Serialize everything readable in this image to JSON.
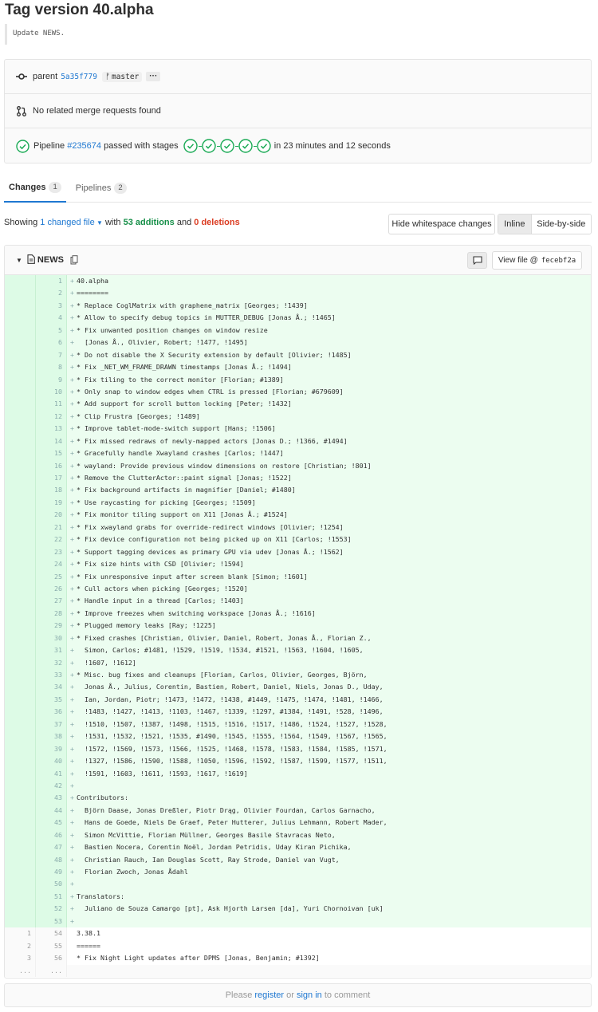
{
  "page": {
    "title": "Tag version 40.alpha",
    "description": "Update NEWS."
  },
  "info": {
    "parent_label": "parent",
    "parent_sha": "5a35f779",
    "branch": "master",
    "ellipsis": "···",
    "merge_requests": "No related merge requests found",
    "pipeline_prefix": "Pipeline",
    "pipeline_id": "#235674",
    "pipeline_status": "passed with stages",
    "pipeline_duration": "in 23 minutes and 12 seconds",
    "stage_count": 5,
    "success_color": "#1aaa55"
  },
  "tabs": [
    {
      "label": "Changes",
      "count": "1"
    },
    {
      "label": "Pipelines",
      "count": "2"
    }
  ],
  "summary": {
    "showing": "Showing",
    "changed": "1 changed file",
    "with": "with",
    "additions": "53 additions",
    "and": "and",
    "deletions": "0 deletions"
  },
  "toolbar": {
    "hide_whitespace": "Hide whitespace changes",
    "inline": "Inline",
    "side_by_side": "Side-by-side"
  },
  "file": {
    "name": "NEWS",
    "view_file_label": "View file @",
    "view_file_sha": "fecebf2a"
  },
  "diff_lines": [
    {
      "t": "add",
      "o": "",
      "n": "1",
      "c": "40.alpha"
    },
    {
      "t": "add",
      "o": "",
      "n": "2",
      "c": "========"
    },
    {
      "t": "add",
      "o": "",
      "n": "3",
      "c": "* Replace CoglMatrix with graphene_matrix [Georges; !1439]"
    },
    {
      "t": "add",
      "o": "",
      "n": "4",
      "c": "* Allow to specify debug topics in MUTTER_DEBUG [Jonas Å.; !1465]"
    },
    {
      "t": "add",
      "o": "",
      "n": "5",
      "c": "* Fix unwanted position changes on window resize"
    },
    {
      "t": "add",
      "o": "",
      "n": "6",
      "c": "  [Jonas Å., Olivier, Robert; !1477, !1495]"
    },
    {
      "t": "add",
      "o": "",
      "n": "7",
      "c": "* Do not disable the X Security extension by default [Olivier; !1485]"
    },
    {
      "t": "add",
      "o": "",
      "n": "8",
      "c": "* Fix _NET_WM_FRAME_DRAWN timestamps [Jonas Å.; !1494]"
    },
    {
      "t": "add",
      "o": "",
      "n": "9",
      "c": "* Fix tiling to the correct monitor [Florian; #1389]"
    },
    {
      "t": "add",
      "o": "",
      "n": "10",
      "c": "* Only snap to window edges when CTRL is pressed [Florian; #679609]"
    },
    {
      "t": "add",
      "o": "",
      "n": "11",
      "c": "* Add support for scroll button locking [Peter; !1432]"
    },
    {
      "t": "add",
      "o": "",
      "n": "12",
      "c": "* Clip Frustra [Georges; !1489]"
    },
    {
      "t": "add",
      "o": "",
      "n": "13",
      "c": "* Improve tablet-mode-switch support [Hans; !1506]"
    },
    {
      "t": "add",
      "o": "",
      "n": "14",
      "c": "* Fix missed redraws of newly-mapped actors [Jonas D.; !1366, #1494]"
    },
    {
      "t": "add",
      "o": "",
      "n": "15",
      "c": "* Gracefully handle Xwayland crashes [Carlos; !1447]"
    },
    {
      "t": "add",
      "o": "",
      "n": "16",
      "c": "* wayland: Provide previous window dimensions on restore [Christian; !801]"
    },
    {
      "t": "add",
      "o": "",
      "n": "17",
      "c": "* Remove the ClutterActor::paint signal [Jonas; !1522]"
    },
    {
      "t": "add",
      "o": "",
      "n": "18",
      "c": "* Fix background artifacts in magnifier [Daniel; #1480]"
    },
    {
      "t": "add",
      "o": "",
      "n": "19",
      "c": "* Use raycasting for picking [Georges; !1509]"
    },
    {
      "t": "add",
      "o": "",
      "n": "20",
      "c": "* Fix monitor tiling support on X11 [Jonas Å.; #1524]"
    },
    {
      "t": "add",
      "o": "",
      "n": "21",
      "c": "* Fix xwayland grabs for override-redirect windows [Olivier; !1254]"
    },
    {
      "t": "add",
      "o": "",
      "n": "22",
      "c": "* Fix device configuration not being picked up on X11 [Carlos; !1553]"
    },
    {
      "t": "add",
      "o": "",
      "n": "23",
      "c": "* Support tagging devices as primary GPU via udev [Jonas Å.; !1562]"
    },
    {
      "t": "add",
      "o": "",
      "n": "24",
      "c": "* Fix size hints with CSD [Olivier; !1594]"
    },
    {
      "t": "add",
      "o": "",
      "n": "25",
      "c": "* Fix unresponsive input after screen blank [Simon; !1601]"
    },
    {
      "t": "add",
      "o": "",
      "n": "26",
      "c": "* Cull actors when picking [Georges; !1520]"
    },
    {
      "t": "add",
      "o": "",
      "n": "27",
      "c": "* Handle input in a thread [Carlos; !1403]"
    },
    {
      "t": "add",
      "o": "",
      "n": "28",
      "c": "* Improve freezes when switching workspace [Jonas Å.; !1616]"
    },
    {
      "t": "add",
      "o": "",
      "n": "29",
      "c": "* Plugged memory leaks [Ray; !1225]"
    },
    {
      "t": "add",
      "o": "",
      "n": "30",
      "c": "* Fixed crashes [Christian, Olivier, Daniel, Robert, Jonas Å., Florian Z.,"
    },
    {
      "t": "add",
      "o": "",
      "n": "31",
      "c": "  Simon, Carlos; #1481, !1529, !1519, !1534, #1521, !1563, !1604, !1605,"
    },
    {
      "t": "add",
      "o": "",
      "n": "32",
      "c": "  !1607, !1612]"
    },
    {
      "t": "add",
      "o": "",
      "n": "33",
      "c": "* Misc. bug fixes and cleanups [Florian, Carlos, Olivier, Georges, Björn,"
    },
    {
      "t": "add",
      "o": "",
      "n": "34",
      "c": "  Jonas Å., Julius, Corentin, Bastien, Robert, Daniel, Niels, Jonas D., Uday,"
    },
    {
      "t": "add",
      "o": "",
      "n": "35",
      "c": "  Ian, Jordan, Piotr; !1473, !1472, !1438, #1449, !1475, !1474, !1481, !1466,"
    },
    {
      "t": "add",
      "o": "",
      "n": "36",
      "c": "  !1483, !1427, !1413, !1103, !1467, !1339, !1297, #1384, !1491, !528, !1496,"
    },
    {
      "t": "add",
      "o": "",
      "n": "37",
      "c": "  !1510, !1507, !1387, !1498, !1515, !1516, !1517, !1486, !1524, !1527, !1528,"
    },
    {
      "t": "add",
      "o": "",
      "n": "38",
      "c": "  !1531, !1532, !1521, !1535, #1490, !1545, !1555, !1564, !1549, !1567, !1565,"
    },
    {
      "t": "add",
      "o": "",
      "n": "39",
      "c": "  !1572, !1569, !1573, !1566, !1525, !1468, !1578, !1583, !1584, !1585, !1571,"
    },
    {
      "t": "add",
      "o": "",
      "n": "40",
      "c": "  !1327, !1586, !1590, !1588, !1050, !1596, !1592, !1587, !1599, !1577, !1511,"
    },
    {
      "t": "add",
      "o": "",
      "n": "41",
      "c": "  !1591, !1603, !1611, !1593, !1617, !1619]"
    },
    {
      "t": "add",
      "o": "",
      "n": "42",
      "c": ""
    },
    {
      "t": "add",
      "o": "",
      "n": "43",
      "c": "Contributors:"
    },
    {
      "t": "add",
      "o": "",
      "n": "44",
      "c": "  Björn Daase, Jonas Dreßler, Piotr Drąg, Olivier Fourdan, Carlos Garnacho,"
    },
    {
      "t": "add",
      "o": "",
      "n": "45",
      "c": "  Hans de Goede, Niels De Graef, Peter Hutterer, Julius Lehmann, Robert Mader,"
    },
    {
      "t": "add",
      "o": "",
      "n": "46",
      "c": "  Simon McVittie, Florian Müllner, Georges Basile Stavracas Neto,"
    },
    {
      "t": "add",
      "o": "",
      "n": "47",
      "c": "  Bastien Nocera, Corentin Noël, Jordan Petridis, Uday Kiran Pichika,"
    },
    {
      "t": "add",
      "o": "",
      "n": "48",
      "c": "  Christian Rauch, Ian Douglas Scott, Ray Strode, Daniel van Vugt,"
    },
    {
      "t": "add",
      "o": "",
      "n": "49",
      "c": "  Florian Zwoch, Jonas Ådahl"
    },
    {
      "t": "add",
      "o": "",
      "n": "50",
      "c": ""
    },
    {
      "t": "add",
      "o": "",
      "n": "51",
      "c": "Translators:"
    },
    {
      "t": "add",
      "o": "",
      "n": "52",
      "c": "  Juliano de Souza Camargo [pt], Ask Hjorth Larsen [da], Yuri Chornoivan [uk]"
    },
    {
      "t": "add",
      "o": "",
      "n": "53",
      "c": ""
    },
    {
      "t": "ctx",
      "o": "1",
      "n": "54",
      "c": "3.38.1"
    },
    {
      "t": "ctx",
      "o": "2",
      "n": "55",
      "c": "======"
    },
    {
      "t": "ctx",
      "o": "3",
      "n": "56",
      "c": "* Fix Night Light updates after DPMS [Jonas, Benjamin; #1392]"
    },
    {
      "t": "match",
      "o": "...",
      "n": "...",
      "c": ""
    }
  ],
  "footer": {
    "please": "Please",
    "register": "register",
    "or": "or",
    "sign_in": "sign in",
    "to_comment": "to comment"
  }
}
